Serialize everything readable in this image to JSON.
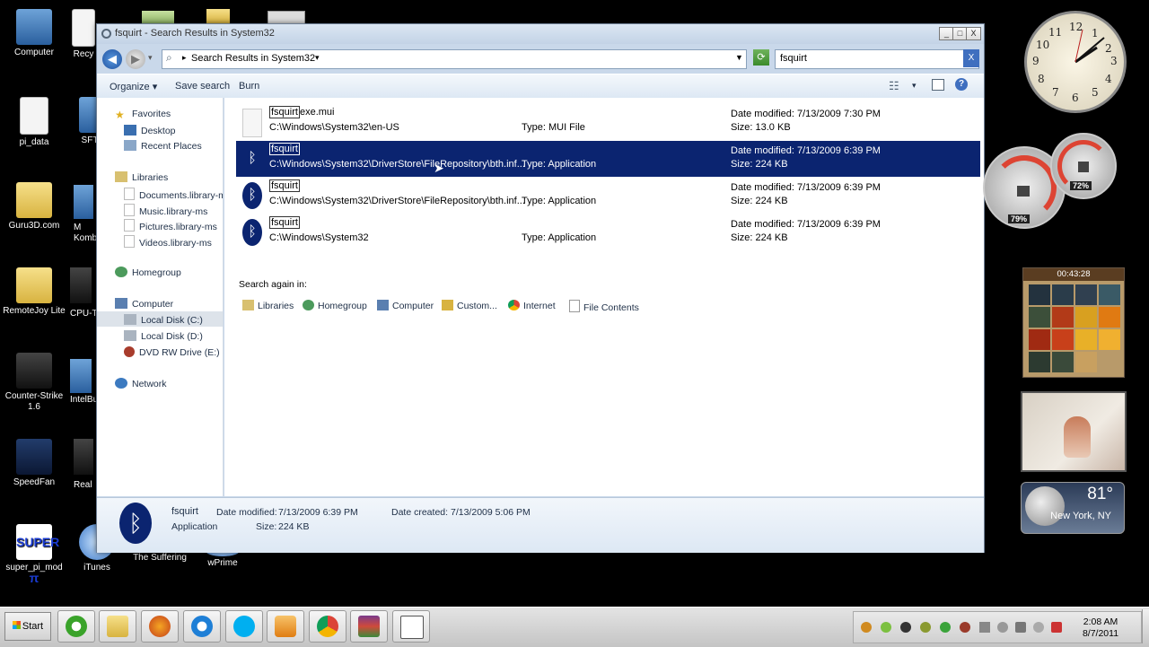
{
  "desktop": {
    "icons": [
      {
        "label": "Computer"
      },
      {
        "label": "Recy"
      },
      {
        "label": "pi_data"
      },
      {
        "label": "SFT"
      },
      {
        "label": "Guru3D.com"
      },
      {
        "label": "M"
      },
      {
        "label": "Komb"
      },
      {
        "label": "RemoteJoy Lite"
      },
      {
        "label": "CPU-T"
      },
      {
        "label": "Counter-Strike 1.6"
      },
      {
        "label": "IntelBu"
      },
      {
        "label": "SpeedFan"
      },
      {
        "label": "Real"
      },
      {
        "label": "super_pi_mod"
      },
      {
        "label": "iTunes"
      },
      {
        "label": "The Suffering"
      },
      {
        "label": "wPrime"
      }
    ],
    "super_icon_text": "SUPER π"
  },
  "window": {
    "title": "fsquirt - Search Results in System32",
    "controls": {
      "minimize": "_",
      "maximize": "□",
      "close": "X"
    },
    "address": {
      "breadcrumb_sep": "▸",
      "location": "Search Results in System32",
      "dropdown": "▾"
    },
    "search": {
      "value": "fsquirt",
      "clear": "X"
    },
    "toolbar": {
      "organize": "Organize",
      "save_search": "Save search",
      "burn": "Burn"
    },
    "nav": {
      "favorites": "Favorites",
      "desktop": "Desktop",
      "recent": "Recent Places",
      "libraries": "Libraries",
      "documents": "Documents.library-m",
      "music": "Music.library-ms",
      "pictures": "Pictures.library-ms",
      "videos": "Videos.library-ms",
      "homegroup": "Homegroup",
      "computer": "Computer",
      "local_c": "Local Disk (C:)",
      "local_d": "Local Disk (D:)",
      "dvd": "DVD RW Drive (E:) S",
      "network": "Network"
    },
    "results": [
      {
        "name_match": "fsquirt",
        "name_rest": "exe.mui",
        "path": "C:\\Windows\\System32\\en-US",
        "type": "Type: MUI File",
        "date": "Date modified: 7/13/2009 7:30 PM",
        "size": "Size: 13.0 KB"
      },
      {
        "name_match": "fsquirt",
        "name_rest": "",
        "path": "C:\\Windows\\System32\\DriverStore\\FileRepository\\bth.inf...",
        "type": "Type: Application",
        "date": "Date modified: 7/13/2009 6:39 PM",
        "size": "Size: 224 KB"
      },
      {
        "name_match": "fsquirt",
        "name_rest": "",
        "path": "C:\\Windows\\System32\\DriverStore\\FileRepository\\bth.inf...",
        "type": "Type: Application",
        "date": "Date modified: 7/13/2009 6:39 PM",
        "size": "Size: 224 KB"
      },
      {
        "name_match": "fsquirt",
        "name_rest": "",
        "path": "C:\\Windows\\System32",
        "type": "Type: Application",
        "date": "Date modified: 7/13/2009 6:39 PM",
        "size": "Size: 224 KB"
      }
    ],
    "search_again": {
      "label": "Search again in:",
      "items": [
        "Libraries",
        "Homegroup",
        "Computer",
        "Custom...",
        "Internet",
        "File Contents"
      ]
    },
    "details": {
      "name": "fsquirt",
      "type": "Application",
      "date_modified_label": "Date modified:",
      "date_modified": "7/13/2009 6:39 PM",
      "size_label": "Size:",
      "size": "224 KB",
      "date_created_label": "Date created:",
      "date_created": "7/13/2009 5:06 PM"
    }
  },
  "gadgets": {
    "clock_numbers": [
      "12",
      "1",
      "2",
      "3",
      "4",
      "5",
      "6",
      "7",
      "8",
      "9",
      "10",
      "11"
    ],
    "cpu_percent": "79%",
    "mem_percent": "72%",
    "puzzle_timer": "00:43:28",
    "weather": {
      "temp": "81°",
      "city": "New York, NY"
    }
  },
  "taskbar": {
    "start": "Start",
    "time": "2:08 AM",
    "date": "8/7/2011"
  },
  "colors": {
    "selection": "#0b2470",
    "window_chrome": "#c9d8ea"
  }
}
